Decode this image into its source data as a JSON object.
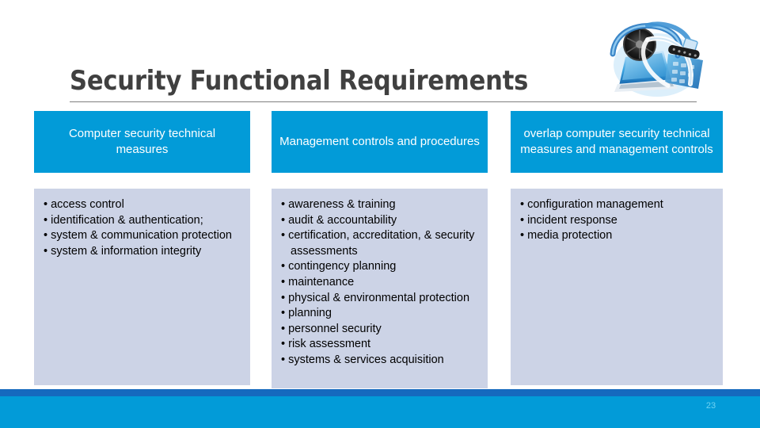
{
  "slide": {
    "title": "Security Functional Requirements",
    "page_number": "23",
    "accent_color": "#029bd8",
    "stripe_color": "#1569be",
    "body_box_color": "#ccd3e6",
    "title_color": "#404040",
    "page_number_color": "#6fd3f3"
  },
  "hero_image": {
    "name": "computer-security-collage-image",
    "description": "blue tinted collage of laptop, network cables, cooling fan and keyboard"
  },
  "columns": [
    {
      "header": "Computer security technical measures",
      "items": [
        "access control",
        "identification & authentication;",
        "system & communication protection",
        "system & information integrity"
      ]
    },
    {
      "header": "Management controls and procedures",
      "items": [
        "awareness & training",
        "audit & accountability",
        "certification, accreditation, & security assessments",
        "contingency planning",
        "maintenance",
        "physical & environmental protection",
        "planning",
        "personnel security",
        "risk assessment",
        "systems & services acquisition"
      ]
    },
    {
      "header": "overlap computer security technical measures and management controls",
      "items": [
        "configuration management",
        "incident response",
        "media protection"
      ]
    }
  ]
}
